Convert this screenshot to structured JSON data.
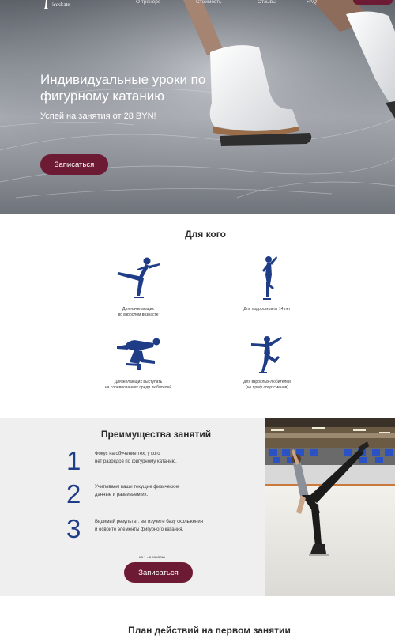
{
  "nav": {
    "logo_text": "iceskate",
    "links": [
      "О тренере",
      "Стоимость",
      "Отзывы",
      "FAQ"
    ]
  },
  "hero": {
    "title": "Индивидуальные уроки по фигурному катанию",
    "subtitle": "Успей на занятия от 28 BYN!",
    "cta": "Записаться"
  },
  "who": {
    "title": "Для кого",
    "items": [
      {
        "icon": "skater-spiral-icon",
        "caption": "Для начинающих\nво взрослом возрасте"
      },
      {
        "icon": "skater-spin-icon",
        "caption": "Для подростков от 14 лет"
      },
      {
        "icon": "skater-sit-spin-icon",
        "caption": "Для желающих выступать\nна соревнованиях среди любителей"
      },
      {
        "icon": "skater-jump-icon",
        "caption": "Для взрослых-любителей\n(не проф.спортсменов)"
      }
    ]
  },
  "advantages": {
    "title": "Преимущества занятий",
    "items": [
      {
        "num": "1",
        "text": "Фокус на обучение тех, у кого\nнет разрядов по фигурному катанию."
      },
      {
        "num": "2",
        "text": "Учитываем ваши текущие физические\nданные и развиваем их."
      },
      {
        "num": "3",
        "text": "Видимый результат: вы изучите базу скольжения\nи освоите элементы фигурного катания."
      }
    ],
    "note": "на 1 - е занятие",
    "cta": "Записаться"
  },
  "plan": {
    "title": "План действий на первом занятии"
  },
  "colors": {
    "accent": "#6d1a35",
    "numbers": "#1f3c86",
    "silhouettes": "#1f3c86"
  }
}
